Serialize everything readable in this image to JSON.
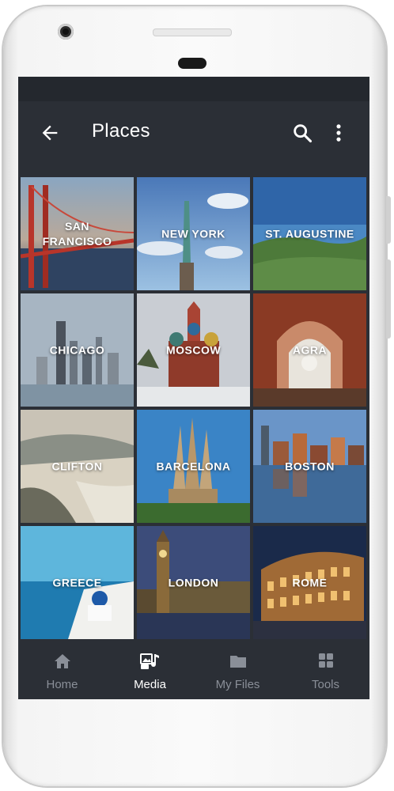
{
  "app": {
    "title": "Places"
  },
  "toolbar": {
    "back_icon": "arrow-back-icon",
    "search_icon": "search-icon",
    "more_icon": "more-vert-icon"
  },
  "places": [
    {
      "label": "SAN\nFRANCISCO"
    },
    {
      "label": "NEW YORK"
    },
    {
      "label": "ST. AUGUSTINE"
    },
    {
      "label": "CHICAGO"
    },
    {
      "label": "MOSCOW"
    },
    {
      "label": "AGRA"
    },
    {
      "label": "CLIFTON"
    },
    {
      "label": "BARCELONA"
    },
    {
      "label": "BOSTON"
    },
    {
      "label": "GREECE"
    },
    {
      "label": "LONDON"
    },
    {
      "label": "ROME"
    }
  ],
  "nav": {
    "items": [
      {
        "label": "Home",
        "icon": "home-icon"
      },
      {
        "label": "Media",
        "icon": "media-icon"
      },
      {
        "label": "My Files",
        "icon": "folder-icon"
      },
      {
        "label": "Tools",
        "icon": "tools-grid-icon"
      }
    ],
    "active_index": 1
  },
  "colors": {
    "appbar": "#2b2f36",
    "statusbar": "#24282e",
    "active_label": "#ffffff",
    "inactive_label": "#8a8f98"
  }
}
